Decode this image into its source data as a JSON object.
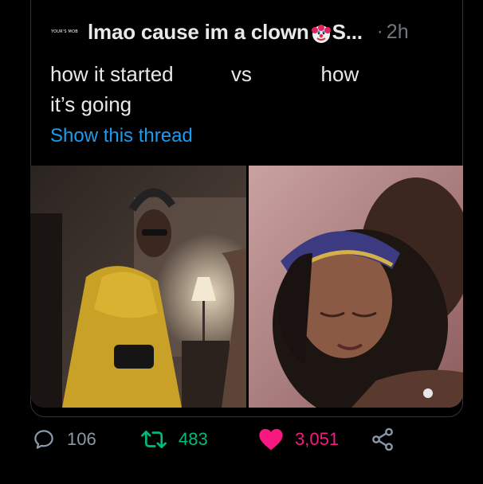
{
  "tweet": {
    "avatar_text": "YOUR'S MOB",
    "display_name_prefix": "lmao cause im a clown",
    "display_name_suffix": "S...",
    "clown_emoji": "clown-face-icon",
    "separator": "·",
    "time": "2h",
    "text": "how it started          vs            how\nit’s going",
    "show_thread": "Show this thread"
  },
  "media": {
    "left_image": "man-in-yellow-sweater-image",
    "right_image": "couple-embracing-image"
  },
  "actions": {
    "reply_count": "106",
    "retweet_count": "483",
    "like_count": "3,051",
    "reply_icon": "reply-icon",
    "retweet_icon": "retweet-icon",
    "like_icon": "heart-icon",
    "share_icon": "share-icon"
  },
  "colors": {
    "background": "#000000",
    "link": "#1d9bf0",
    "retweet": "#00ba7c",
    "like": "#f91880",
    "muted": "#71767b"
  }
}
